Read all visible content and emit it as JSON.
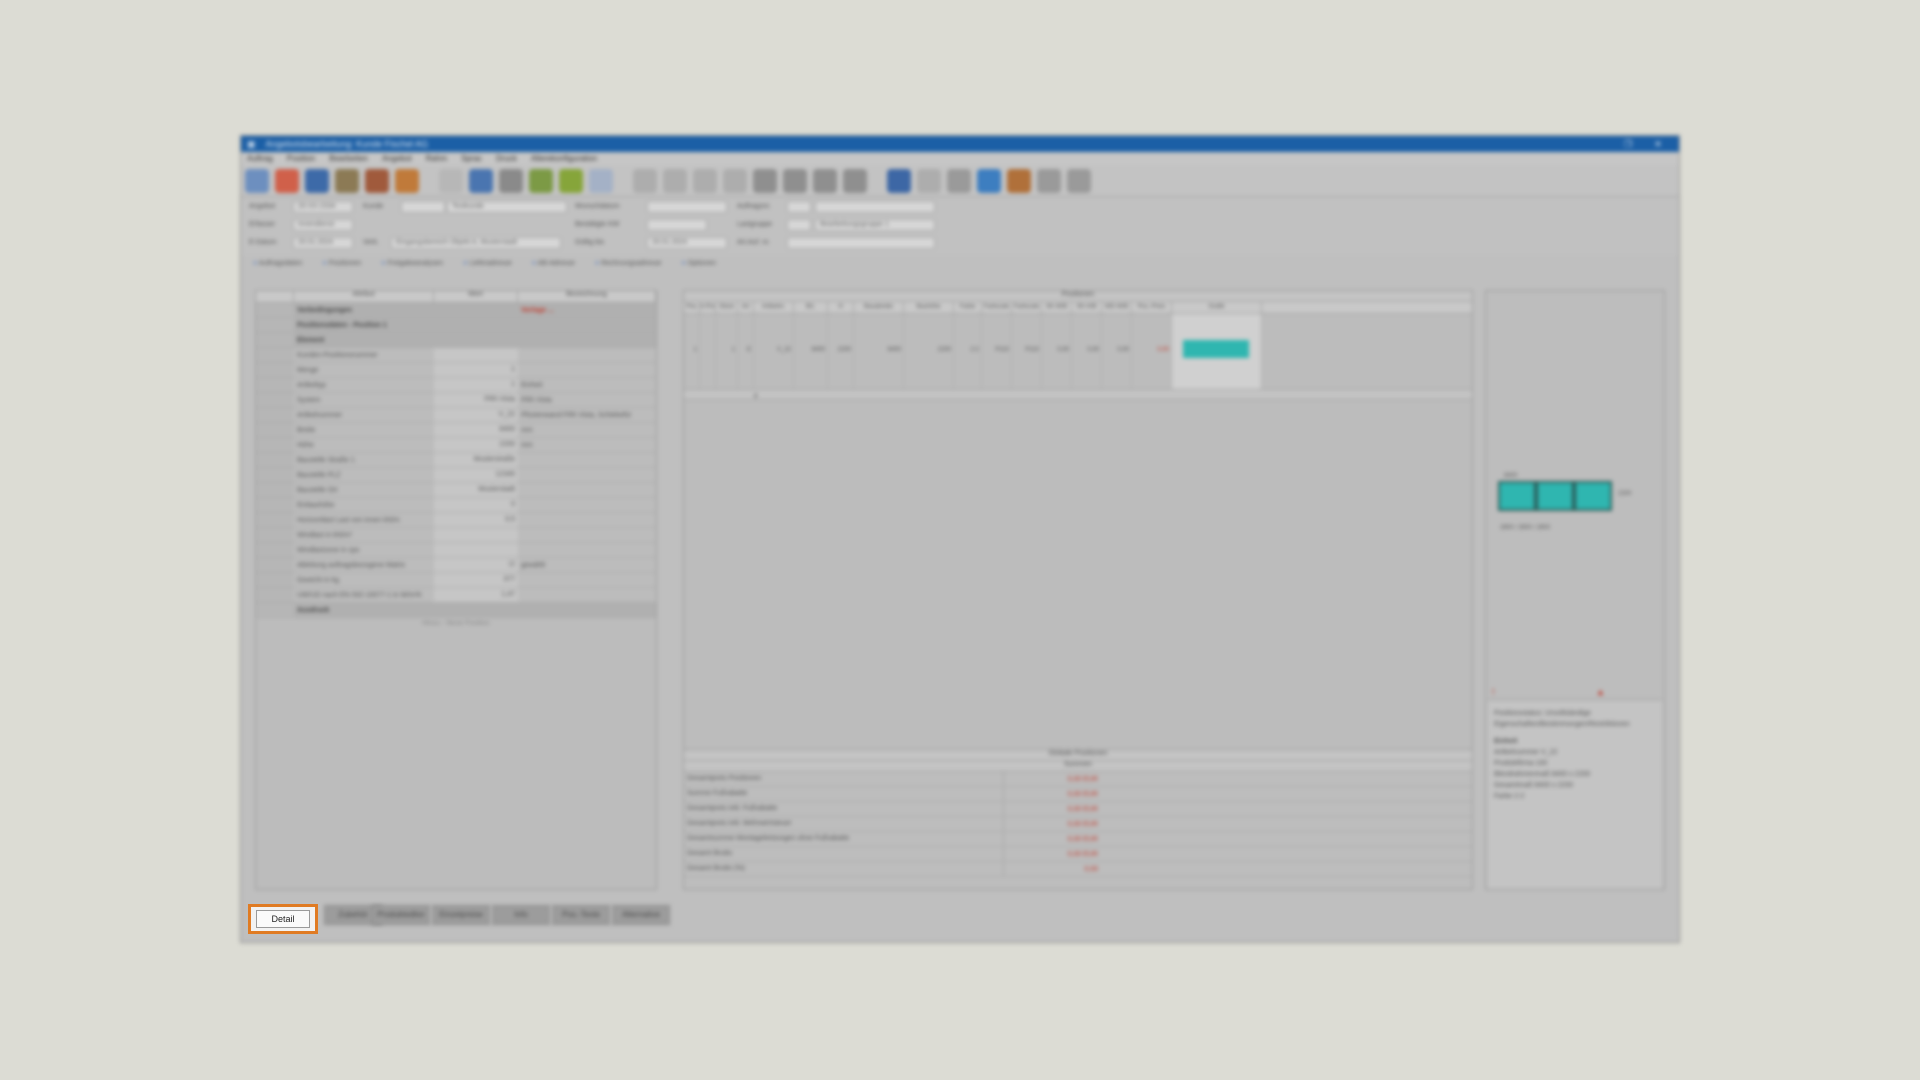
{
  "window": {
    "title": "Angebotsbearbeitung: Kunde Fischel AG",
    "menu": [
      "Auftrag",
      "Position",
      "Bearbeiten",
      "Angebot",
      "Rahm",
      "Sprac",
      "Druck",
      "Allerekonfiguration"
    ]
  },
  "form": {
    "angebot_label": "Angebot",
    "angebot_value": "20-XX-2334",
    "kunde_label": "Kunde",
    "kunde_value": "Testkunde",
    "erfasser_label": "Erfasser",
    "erfasser_value": "Innendienst",
    "datum_label": "E-Datum",
    "datum_value": "20.01.2024",
    "verk_label": "Verk.",
    "verk_value": "Eingangsbereich Objekt A, Musterstadt",
    "wunsch_label": "Wunschdatum",
    "bestaetig_label": "Bestätigte KW",
    "gueltig_label": "Gültig bis",
    "gueltig_value": "20.01.2024",
    "auftrag_label": "Auftragsnr.",
    "lastgruppe_label": "Lastgruppe",
    "lastgruppe_value": "Bearbeitungsgruppe 1",
    "artauf_label": "Art.Auf. nr."
  },
  "tabs": [
    "Auftragsdaten",
    "Positionen",
    "Freigabeanalysen",
    "Lieferadresse",
    "AB-Adresse",
    "Rechnungsadresse",
    "Optionen"
  ],
  "properties": {
    "headers": [
      "Attribut",
      "Wert",
      "Bezeichnung"
    ],
    "rows": [
      {
        "type": "group",
        "name": "Vorbedingungen",
        "value": "",
        "desc": "Vorlage ..."
      },
      {
        "type": "group",
        "name": "Positionsdaten - Position 1",
        "value": "",
        "desc": ""
      },
      {
        "type": "group",
        "name": "Element",
        "value": "",
        "desc": ""
      },
      {
        "type": "row",
        "name": "Kunden-Positionsnummer",
        "value": "",
        "desc": ""
      },
      {
        "type": "row",
        "name": "Menge",
        "value": "1",
        "desc": ""
      },
      {
        "type": "row",
        "name": "Artikeltyp",
        "value": "1",
        "desc": "Einheit"
      },
      {
        "type": "row",
        "name": "System",
        "value": "FRh Vista",
        "desc": "FRh Vista"
      },
      {
        "type": "row",
        "name": "Artikelnummer",
        "value": "V_22",
        "desc": "Pfostenwand FRh Vista, Schiebefür"
      },
      {
        "type": "row",
        "name": "Breite",
        "value": "8400",
        "desc": "mm"
      },
      {
        "type": "row",
        "name": "Höhe",
        "value": "2200",
        "desc": "mm"
      },
      {
        "type": "row",
        "name": "Baustelle Straße 1",
        "value": "Musterstraße",
        "desc": ""
      },
      {
        "type": "row",
        "name": "Baustelle PLZ",
        "value": "12345",
        "desc": ""
      },
      {
        "type": "row",
        "name": "Baustelle Ort",
        "value": "Musterstadt",
        "desc": ""
      },
      {
        "type": "row",
        "name": "Einbauhöhe",
        "value": "0",
        "desc": ""
      },
      {
        "type": "row",
        "name": "Horizontlast Last von innen kN/m",
        "value": "0,5",
        "desc": ""
      },
      {
        "type": "row",
        "name": "Windlast in kN/m²",
        "value": "",
        "desc": ""
      },
      {
        "type": "row",
        "name": "Windlastzone in cps",
        "value": "",
        "desc": ""
      },
      {
        "type": "row",
        "name": "Ableitung auftragsbezogene Matrix",
        "value": "☑",
        "desc": "gewählt"
      },
      {
        "type": "row",
        "name": "Gewicht in kg",
        "value": "377",
        "desc": ""
      },
      {
        "type": "row",
        "name": "UW/UD nach EN ISO 10077-1 in W/m²K",
        "value": "1,47",
        "desc": ""
      },
      {
        "type": "group",
        "name": "Ausdruck",
        "value": "",
        "desc": ""
      }
    ],
    "footer": "Hinzu - Neue Position"
  },
  "grid": {
    "title": "Positionen",
    "headers": [
      "Pos",
      "A-Pos",
      "Stück",
      "Art",
      "Artikelnr.",
      "B/L",
      "H",
      "Bauabreite",
      "Bauhöhe",
      "Farbe",
      "Farbcode",
      "Farbcode",
      "SK-W/B",
      "SK-H/B",
      "WD-W/B",
      "Pos.-Preis",
      "Grafik"
    ],
    "row": [
      "1",
      "",
      "1",
      "E",
      "V_22",
      "8400",
      "2200",
      "8400",
      "2200",
      "2-2",
      "P110",
      "P110",
      "0,00",
      "0,00",
      "0,00",
      "0,00",
      ""
    ],
    "row2_stueck": "0"
  },
  "summary": {
    "title": "Globale Positionen",
    "col_header": "Summen",
    "rows": [
      {
        "label": "Gesamtpreis Positionen",
        "value": "0,00 EUR"
      },
      {
        "label": "Summe Fußrabatte",
        "value": "0,00 EUR"
      },
      {
        "label": "Gesamtpreis inkl. Fußrabatte",
        "value": "0,00 EUR"
      },
      {
        "label": "Gesamtpreis inkl. Mehrwertsteuer",
        "value": "0,00 EUR"
      },
      {
        "label": "Gesamtsumme Montageleistungen ohne Fußrabatte",
        "value": "0,00 EUR"
      },
      {
        "label": "Gesamt Brutto",
        "value": "0,00 EUR"
      },
      {
        "label": "Gesamt Brutto (%)",
        "value": "0,00"
      }
    ]
  },
  "preview": {
    "dimension_top": "8400",
    "dimension_side": "2200",
    "dimension_bottom": "2800 / 2800 / 2800"
  },
  "info": {
    "status": "Positionsstatus: Unvollständige Eigenschaften/Bestimmungen/Restriktionen",
    "section": "Einheit",
    "lines": [
      "Artikelnummer  V_22",
      "Produktfirma  100",
      "Blendrahmenmaß  8400 x 2200",
      "Gesamtmaß  8400 x 2200",
      "Farbe  2-2"
    ]
  },
  "bottom_tabs": [
    "Detail",
    "Zubehör",
    "Produkteditor",
    "Einzelpreise",
    "Info",
    "Pos.-Texte",
    "Alternative"
  ],
  "colors": {
    "highlight": "#e07b23",
    "titlebar": "#1b5fa6",
    "glass": "#2fb6b0"
  }
}
